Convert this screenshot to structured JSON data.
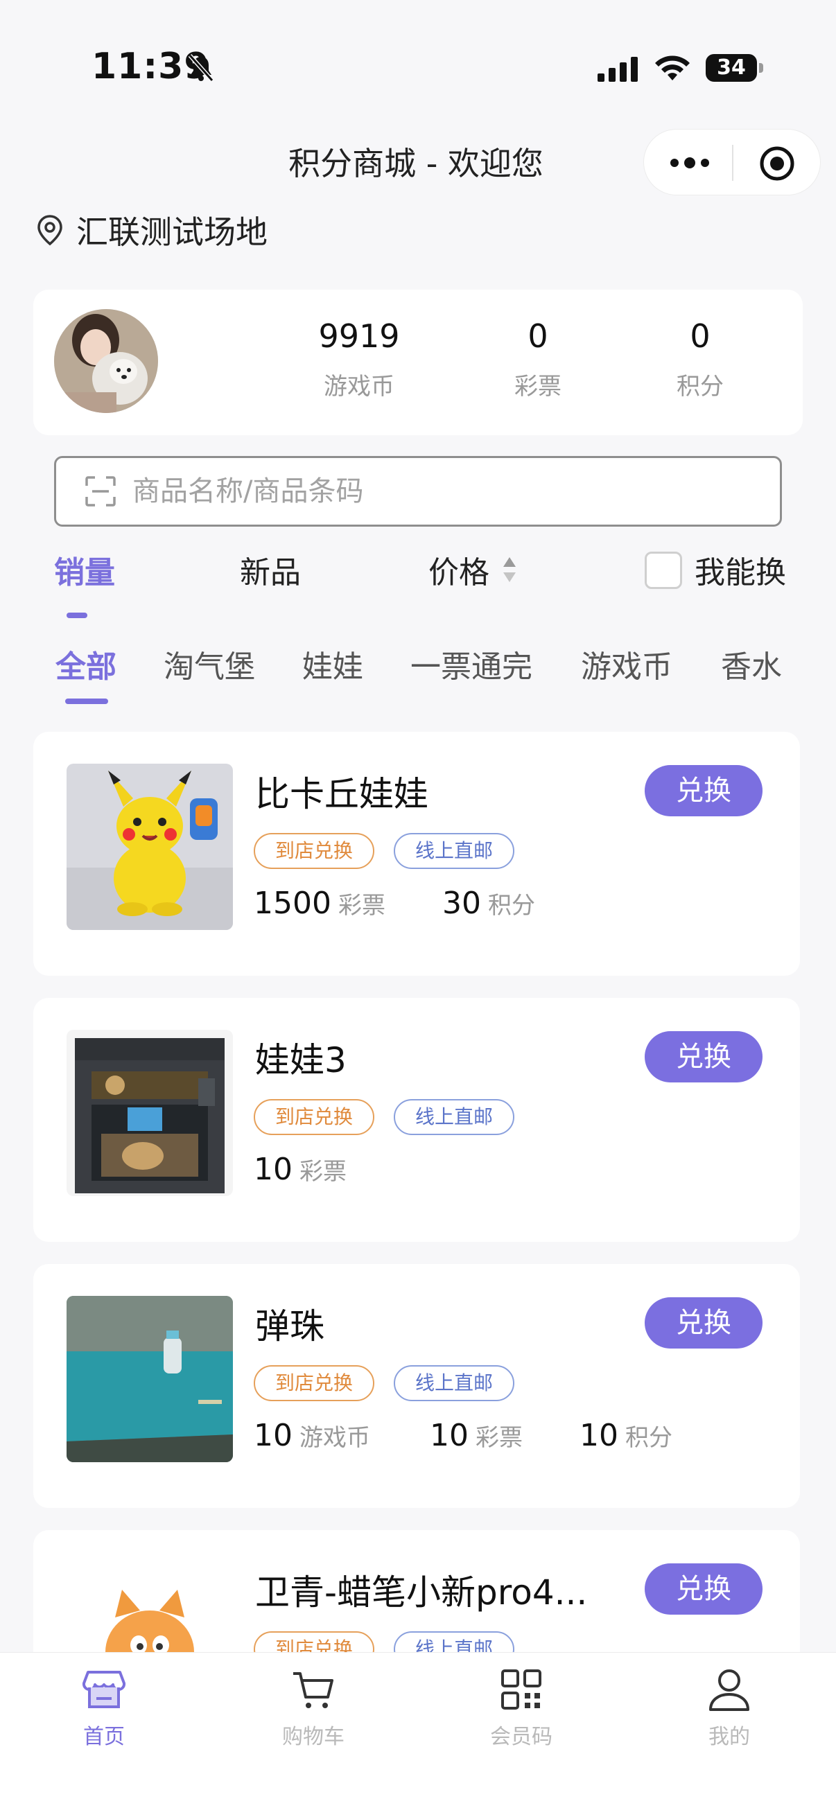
{
  "status_bar": {
    "time": "11:39",
    "battery": "34"
  },
  "nav": {
    "title": "积分商城 - 欢迎您"
  },
  "location": {
    "name": "汇联测试场地"
  },
  "user": {
    "stats": [
      {
        "value": "9919",
        "label": "游戏币"
      },
      {
        "value": "0",
        "label": "彩票"
      },
      {
        "value": "0",
        "label": "积分"
      }
    ]
  },
  "search": {
    "placeholder": "商品名称/商品条码"
  },
  "sort_tabs": [
    {
      "label": "销量",
      "active": true
    },
    {
      "label": "新品",
      "active": false
    },
    {
      "label": "价格",
      "active": false
    }
  ],
  "filter": {
    "can_redeem_label": "我能换",
    "checked": false
  },
  "category_tabs": [
    {
      "label": "全部",
      "active": true
    },
    {
      "label": "淘气堡"
    },
    {
      "label": "娃娃"
    },
    {
      "label": "一票通完"
    },
    {
      "label": "游戏币"
    },
    {
      "label": "香水"
    }
  ],
  "tags": {
    "store": "到店兑换",
    "online": "线上直邮"
  },
  "redeem_label": "兑换",
  "products": [
    {
      "name": "比卡丘娃娃",
      "prices": [
        {
          "amount": "1500",
          "unit": "彩票"
        },
        {
          "amount": "30",
          "unit": "积分"
        }
      ]
    },
    {
      "name": "娃娃3",
      "prices": [
        {
          "amount": "10",
          "unit": "彩票"
        }
      ]
    },
    {
      "name": "弹珠",
      "prices": [
        {
          "amount": "10",
          "unit": "游戏币"
        },
        {
          "amount": "10",
          "unit": "彩票"
        },
        {
          "amount": "10",
          "unit": "积分"
        }
      ]
    },
    {
      "name": "卫青-蜡笔小新pro4...",
      "prices": []
    }
  ],
  "tabbar": [
    {
      "label": "首页",
      "icon": "store-icon",
      "active": true
    },
    {
      "label": "购物车",
      "icon": "cart-icon",
      "active": false
    },
    {
      "label": "会员码",
      "icon": "qr-code-icon",
      "active": false
    },
    {
      "label": "我的",
      "icon": "user-icon",
      "active": false
    }
  ],
  "colors": {
    "accent": "#7b70dd",
    "tag_store": "#e08a3c",
    "tag_online": "#5b74c9",
    "background": "#f7f7f9"
  }
}
